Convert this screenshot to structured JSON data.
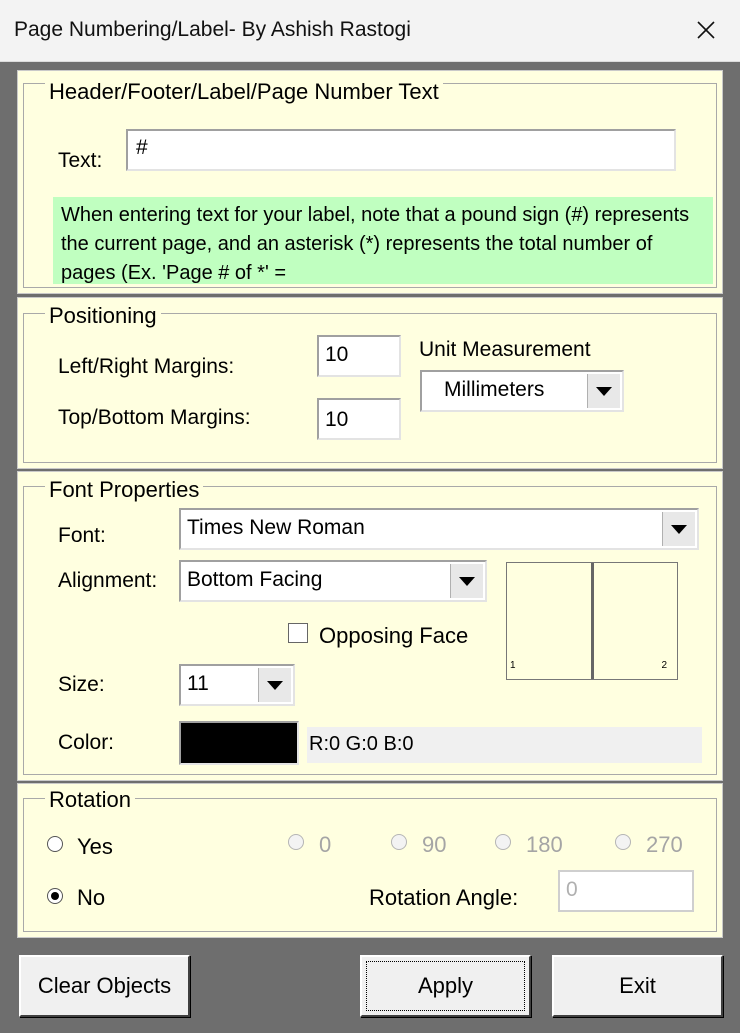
{
  "window": {
    "title": "Page Numbering/Label- By Ashish Rastogi"
  },
  "header_section": {
    "legend": "Header/Footer/Label/Page Number Text",
    "text_label": "Text:",
    "text_value": "#",
    "note": "When entering text for your label, note that a pound sign (#) represents the current page, and an asterisk (*) represents the total number of pages (Ex. 'Page # of *' ="
  },
  "positioning": {
    "legend": "Positioning",
    "lr_label": "Left/Right Margins:",
    "lr_value": "10",
    "tb_label": "Top/Bottom Margins:",
    "tb_value": "10",
    "unit_label": "Unit Measurement",
    "unit_value": "Millimeters"
  },
  "font": {
    "legend": "Font Properties",
    "font_label": "Font:",
    "font_value": "Times New Roman",
    "align_label": "Alignment:",
    "align_value": "Bottom Facing",
    "opposing_label": "Opposing Face",
    "opposing_checked": false,
    "size_label": "Size:",
    "size_value": "11",
    "color_label": "Color:",
    "color_hex": "#000000",
    "color_text": "R:0 G:0 B:0",
    "preview_page1": "1",
    "preview_page2": "2"
  },
  "rotation": {
    "legend": "Rotation",
    "yes_label": "Yes",
    "no_label": "No",
    "selected": "No",
    "angles": [
      "0",
      "90",
      "180",
      "270"
    ],
    "angle_label": "Rotation Angle:",
    "angle_value": "0"
  },
  "buttons": {
    "clear": "Clear Objects",
    "apply": "Apply",
    "exit": "Exit"
  }
}
